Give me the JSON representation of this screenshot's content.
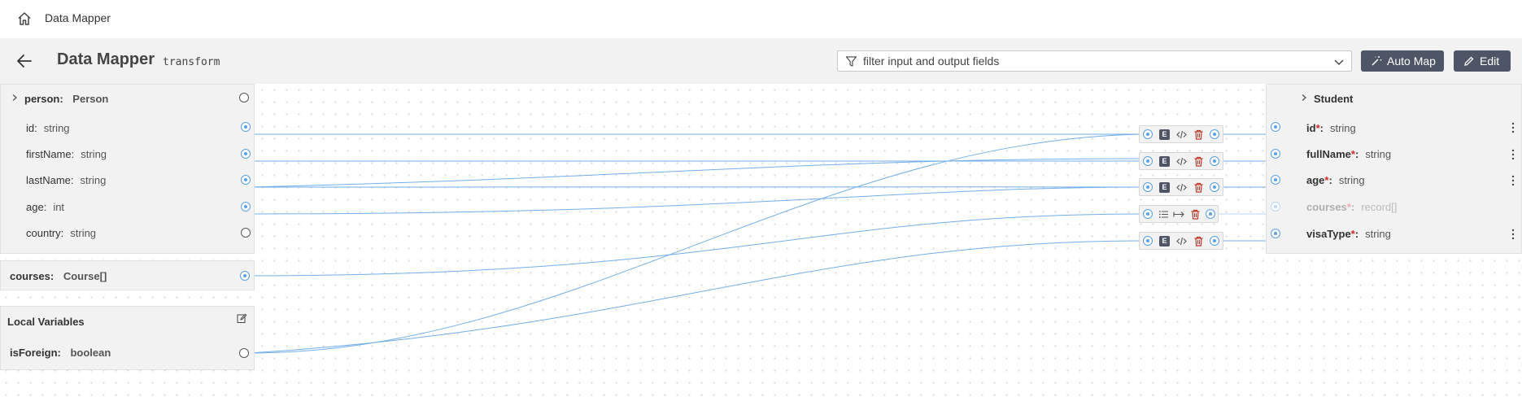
{
  "topbar": {
    "title": "Data Mapper"
  },
  "header": {
    "title": "Data Mapper",
    "subtitle": "transform",
    "filter_placeholder": "filter input and output fields",
    "automap_label": "Auto Map",
    "edit_label": "Edit"
  },
  "input": {
    "record": {
      "name": "person:",
      "type": "Person"
    },
    "fields": [
      {
        "name": "id:",
        "type": "string",
        "mapped": true
      },
      {
        "name": "firstName:",
        "type": "string",
        "mapped": true
      },
      {
        "name": "lastName:",
        "type": "string",
        "mapped": true
      },
      {
        "name": "age:",
        "type": "int",
        "mapped": true
      },
      {
        "name": "country:",
        "type": "string",
        "mapped": false
      }
    ],
    "courses": {
      "name": "courses:",
      "type": "Course[]"
    }
  },
  "local_variables": {
    "title": "Local Variables",
    "vars": [
      {
        "name": "isForeign:",
        "type": "boolean"
      }
    ]
  },
  "output": {
    "record": {
      "name": "Student"
    },
    "fields": [
      {
        "name": "id",
        "req": "*",
        "colon": ":",
        "type": "string"
      },
      {
        "name": "fullName",
        "req": "*",
        "colon": ":",
        "type": "string"
      },
      {
        "name": "age",
        "req": "*",
        "colon": ":",
        "type": "string"
      },
      {
        "name": "courses",
        "req": "*",
        "colon": ":",
        "type": "record[]"
      },
      {
        "name": "visaType",
        "req": "*",
        "colon": ":",
        "type": "string"
      }
    ]
  },
  "mapping_nodes": [
    {
      "kind": "expression",
      "badge": "E"
    },
    {
      "kind": "expression",
      "badge": "E"
    },
    {
      "kind": "expression",
      "badge": "E"
    },
    {
      "kind": "array"
    },
    {
      "kind": "expression",
      "badge": "E"
    }
  ],
  "colors": {
    "link": "#5aa0e6",
    "delete": "#c0392b",
    "button": "#4d5566",
    "panel": "#f2f2f2"
  }
}
